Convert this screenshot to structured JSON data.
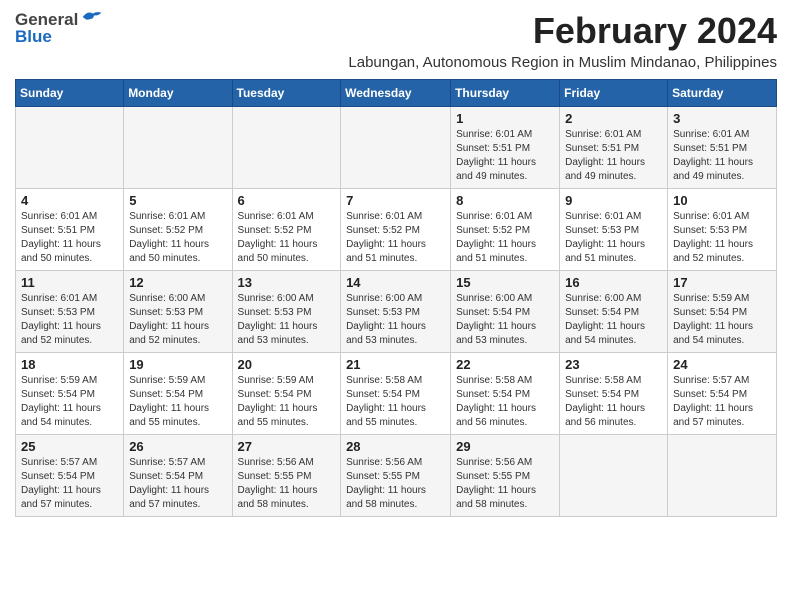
{
  "logo": {
    "general": "General",
    "blue": "Blue"
  },
  "title": "February 2024",
  "subtitle": "Labungan, Autonomous Region in Muslim Mindanao, Philippines",
  "days_of_week": [
    "Sunday",
    "Monday",
    "Tuesday",
    "Wednesday",
    "Thursday",
    "Friday",
    "Saturday"
  ],
  "weeks": [
    [
      {
        "day": "",
        "info": ""
      },
      {
        "day": "",
        "info": ""
      },
      {
        "day": "",
        "info": ""
      },
      {
        "day": "",
        "info": ""
      },
      {
        "day": "1",
        "info": "Sunrise: 6:01 AM\nSunset: 5:51 PM\nDaylight: 11 hours and 49 minutes."
      },
      {
        "day": "2",
        "info": "Sunrise: 6:01 AM\nSunset: 5:51 PM\nDaylight: 11 hours and 49 minutes."
      },
      {
        "day": "3",
        "info": "Sunrise: 6:01 AM\nSunset: 5:51 PM\nDaylight: 11 hours and 49 minutes."
      }
    ],
    [
      {
        "day": "4",
        "info": "Sunrise: 6:01 AM\nSunset: 5:51 PM\nDaylight: 11 hours and 50 minutes."
      },
      {
        "day": "5",
        "info": "Sunrise: 6:01 AM\nSunset: 5:52 PM\nDaylight: 11 hours and 50 minutes."
      },
      {
        "day": "6",
        "info": "Sunrise: 6:01 AM\nSunset: 5:52 PM\nDaylight: 11 hours and 50 minutes."
      },
      {
        "day": "7",
        "info": "Sunrise: 6:01 AM\nSunset: 5:52 PM\nDaylight: 11 hours and 51 minutes."
      },
      {
        "day": "8",
        "info": "Sunrise: 6:01 AM\nSunset: 5:52 PM\nDaylight: 11 hours and 51 minutes."
      },
      {
        "day": "9",
        "info": "Sunrise: 6:01 AM\nSunset: 5:53 PM\nDaylight: 11 hours and 51 minutes."
      },
      {
        "day": "10",
        "info": "Sunrise: 6:01 AM\nSunset: 5:53 PM\nDaylight: 11 hours and 52 minutes."
      }
    ],
    [
      {
        "day": "11",
        "info": "Sunrise: 6:01 AM\nSunset: 5:53 PM\nDaylight: 11 hours and 52 minutes."
      },
      {
        "day": "12",
        "info": "Sunrise: 6:00 AM\nSunset: 5:53 PM\nDaylight: 11 hours and 52 minutes."
      },
      {
        "day": "13",
        "info": "Sunrise: 6:00 AM\nSunset: 5:53 PM\nDaylight: 11 hours and 53 minutes."
      },
      {
        "day": "14",
        "info": "Sunrise: 6:00 AM\nSunset: 5:53 PM\nDaylight: 11 hours and 53 minutes."
      },
      {
        "day": "15",
        "info": "Sunrise: 6:00 AM\nSunset: 5:54 PM\nDaylight: 11 hours and 53 minutes."
      },
      {
        "day": "16",
        "info": "Sunrise: 6:00 AM\nSunset: 5:54 PM\nDaylight: 11 hours and 54 minutes."
      },
      {
        "day": "17",
        "info": "Sunrise: 5:59 AM\nSunset: 5:54 PM\nDaylight: 11 hours and 54 minutes."
      }
    ],
    [
      {
        "day": "18",
        "info": "Sunrise: 5:59 AM\nSunset: 5:54 PM\nDaylight: 11 hours and 54 minutes."
      },
      {
        "day": "19",
        "info": "Sunrise: 5:59 AM\nSunset: 5:54 PM\nDaylight: 11 hours and 55 minutes."
      },
      {
        "day": "20",
        "info": "Sunrise: 5:59 AM\nSunset: 5:54 PM\nDaylight: 11 hours and 55 minutes."
      },
      {
        "day": "21",
        "info": "Sunrise: 5:58 AM\nSunset: 5:54 PM\nDaylight: 11 hours and 55 minutes."
      },
      {
        "day": "22",
        "info": "Sunrise: 5:58 AM\nSunset: 5:54 PM\nDaylight: 11 hours and 56 minutes."
      },
      {
        "day": "23",
        "info": "Sunrise: 5:58 AM\nSunset: 5:54 PM\nDaylight: 11 hours and 56 minutes."
      },
      {
        "day": "24",
        "info": "Sunrise: 5:57 AM\nSunset: 5:54 PM\nDaylight: 11 hours and 57 minutes."
      }
    ],
    [
      {
        "day": "25",
        "info": "Sunrise: 5:57 AM\nSunset: 5:54 PM\nDaylight: 11 hours and 57 minutes."
      },
      {
        "day": "26",
        "info": "Sunrise: 5:57 AM\nSunset: 5:54 PM\nDaylight: 11 hours and 57 minutes."
      },
      {
        "day": "27",
        "info": "Sunrise: 5:56 AM\nSunset: 5:55 PM\nDaylight: 11 hours and 58 minutes."
      },
      {
        "day": "28",
        "info": "Sunrise: 5:56 AM\nSunset: 5:55 PM\nDaylight: 11 hours and 58 minutes."
      },
      {
        "day": "29",
        "info": "Sunrise: 5:56 AM\nSunset: 5:55 PM\nDaylight: 11 hours and 58 minutes."
      },
      {
        "day": "",
        "info": ""
      },
      {
        "day": "",
        "info": ""
      }
    ]
  ]
}
